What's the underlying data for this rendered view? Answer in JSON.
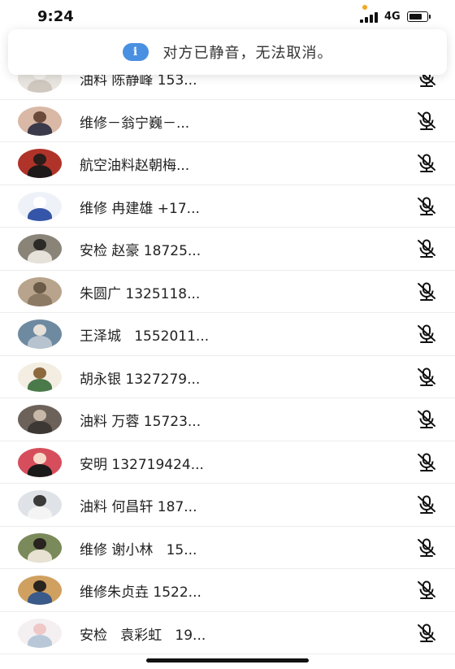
{
  "status_bar": {
    "time": "9:24",
    "network": "4G",
    "battery_level": 0.8
  },
  "toast": {
    "icon": "info-icon",
    "message": "对方已静音，无法取消。"
  },
  "members": [
    {
      "name": "油料 陈静峰 153...",
      "avatar_bg": "#e8e4df",
      "avatar_head": "#f5f2ee",
      "avatar_body": "#cfc8bf",
      "mute_icon": "muted-microphone-icon"
    },
    {
      "name": "维修－翁宁巍－...",
      "avatar_bg": "#d9b8a6",
      "avatar_head": "#6b4a3c",
      "avatar_body": "#3a3a4a",
      "mute_icon": "muted-microphone-icon"
    },
    {
      "name": "航空油料赵朝梅...",
      "avatar_bg": "#b0332a",
      "avatar_head": "#2a1d1a",
      "avatar_body": "#1e1a1a",
      "mute_icon": "muted-microphone-icon"
    },
    {
      "name": "维修 冉建雄 +17...",
      "avatar_bg": "#eef2f8",
      "avatar_head": "#ffffff",
      "avatar_body": "#3556a8",
      "mute_icon": "muted-microphone-icon"
    },
    {
      "name": "安检 赵豪 18725...",
      "avatar_bg": "#8a8478",
      "avatar_head": "#2c2a27",
      "avatar_body": "#e6e2da",
      "mute_icon": "muted-microphone-icon"
    },
    {
      "name": "朱圆广 1325118...",
      "avatar_bg": "#b8a48c",
      "avatar_head": "#6a5a48",
      "avatar_body": "#8c7a64",
      "mute_icon": "muted-microphone-icon"
    },
    {
      "name": "王泽城   1552011...",
      "avatar_bg": "#6e8aa0",
      "avatar_head": "#e6e0d8",
      "avatar_body": "#b7c4cf",
      "mute_icon": "muted-microphone-icon"
    },
    {
      "name": "胡永银 1327279...",
      "avatar_bg": "#f3ede2",
      "avatar_head": "#8c6a3e",
      "avatar_body": "#4a7a4a",
      "mute_icon": "muted-microphone-icon"
    },
    {
      "name": "油料 万蓉 15723...",
      "avatar_bg": "#6c625a",
      "avatar_head": "#c8b8a8",
      "avatar_body": "#3e3834",
      "mute_icon": "muted-microphone-icon"
    },
    {
      "name": "安明 132719424...",
      "avatar_bg": "#d64e5c",
      "avatar_head": "#f6d9c8",
      "avatar_body": "#1a1a1a",
      "mute_icon": "muted-microphone-icon"
    },
    {
      "name": "油料 何昌轩 187...",
      "avatar_bg": "#dfe3e8",
      "avatar_head": "#3a3a3a",
      "avatar_body": "#f4f4f4",
      "mute_icon": "muted-microphone-icon"
    },
    {
      "name": "维修 谢小林   15...",
      "avatar_bg": "#7a8a5a",
      "avatar_head": "#2a2420",
      "avatar_body": "#e8e2d2",
      "mute_icon": "muted-microphone-icon"
    },
    {
      "name": "维修朱贞垚 1522...",
      "avatar_bg": "#d0a060",
      "avatar_head": "#2a2420",
      "avatar_body": "#3a5a8a",
      "mute_icon": "muted-microphone-icon"
    },
    {
      "name": "安检   袁彩虹   19...",
      "avatar_bg": "#f4f0f2",
      "avatar_head": "#f0c8c8",
      "avatar_body": "#b8c8d8",
      "mute_icon": "muted-microphone-icon"
    }
  ]
}
